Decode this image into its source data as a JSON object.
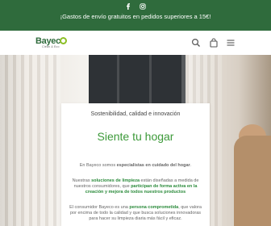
{
  "topbar": {
    "social": [
      {
        "icon": "facebook-icon"
      },
      {
        "icon": "instagram-icon"
      }
    ],
    "promo_text": "¡Gastos de envío gratuitos en pedidos superiores a 15€!"
  },
  "navbar": {
    "logo_text": "Bayec",
    "logo_sub": "Clean & Eco",
    "icons": [
      "search-icon",
      "bag-icon",
      "menu-icon"
    ]
  },
  "hero": {
    "kicker": "Sostenibilidad, calidad e innovación",
    "headline": "Siente tu hogar",
    "p1": {
      "pre": "En Bayeco somos ",
      "strong": "especialistas en cuidado del hogar",
      "post": "."
    },
    "p2": {
      "pre": "Nuestras ",
      "strong1": "soluciones de limpieza",
      "mid": " están diseñadas a medida de nuestros consumidores, que ",
      "strong2": "participan de forma activa en la creación y mejora de todos nuestros productos",
      "post": ""
    },
    "p3": {
      "pre": "El consumidor Bayeco es una ",
      "strong1": "persona comprometida",
      "mid": ", que valora por encima de todo la calidad y que busca soluciones innovadoras para hacer su limpieza diaria más fácil y eficaz."
    }
  },
  "colors": {
    "brand_green": "#2f6b3c",
    "accent_green": "#3d9a3a",
    "logo_lime": "#8cbf26"
  }
}
